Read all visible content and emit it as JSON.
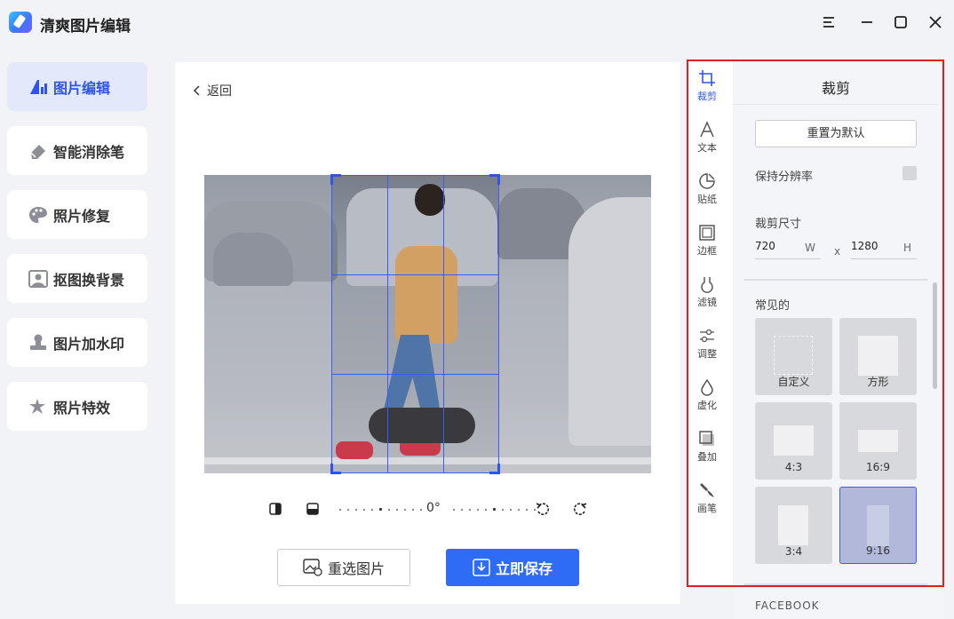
{
  "app": {
    "title": "清爽图片编辑",
    "window_controls": [
      "menu-icon",
      "minimize-icon",
      "maximize-icon",
      "close-icon"
    ]
  },
  "nav": {
    "items": [
      {
        "label": "图片编辑",
        "icon": "image-edit-icon",
        "active": true
      },
      {
        "label": "智能消除笔",
        "icon": "eraser-icon",
        "active": false
      },
      {
        "label": "照片修复",
        "icon": "palette-icon",
        "active": false
      },
      {
        "label": "抠图换背景",
        "icon": "portrait-icon",
        "active": false
      },
      {
        "label": "图片加水印",
        "icon": "stamp-icon",
        "active": false
      },
      {
        "label": "照片特效",
        "icon": "sparkle-icon",
        "active": false
      }
    ]
  },
  "editor": {
    "back_label": "返回",
    "rotation_angle": "0°",
    "reselect_label": "重选图片",
    "save_label": "立即保存"
  },
  "tools": [
    {
      "label": "裁剪",
      "icon": "crop-icon",
      "active": true
    },
    {
      "label": "文本",
      "icon": "text-icon",
      "active": false
    },
    {
      "label": "贴纸",
      "icon": "sticker-icon",
      "active": false
    },
    {
      "label": "边框",
      "icon": "frame-icon",
      "active": false
    },
    {
      "label": "滤镜",
      "icon": "filter-icon",
      "active": false
    },
    {
      "label": "调整",
      "icon": "adjust-icon",
      "active": false
    },
    {
      "label": "虚化",
      "icon": "blur-drop-icon",
      "active": false
    },
    {
      "label": "叠加",
      "icon": "overlay-icon",
      "active": false
    },
    {
      "label": "画笔",
      "icon": "brush-icon",
      "active": false
    }
  ],
  "crop_panel": {
    "title": "裁剪",
    "reset_label": "重置为默认",
    "keep_resolution_label": "保持分辨率",
    "size_label": "裁剪尺寸",
    "width_value": "720",
    "width_unit": "W",
    "separator": "x",
    "height_value": "1280",
    "height_unit": "H",
    "common_label": "常见的",
    "presets": [
      {
        "label": "自定义",
        "selected": false
      },
      {
        "label": "方形",
        "selected": false
      },
      {
        "label": "4:3",
        "selected": false
      },
      {
        "label": "16:9",
        "selected": false
      },
      {
        "label": "3:4",
        "selected": false
      },
      {
        "label": "9:16",
        "selected": true
      }
    ],
    "next_section_label": "FACEBOOK"
  },
  "colors": {
    "accent": "#2f54eb",
    "save_button": "#2f6cf6",
    "highlight_border": "#e0201e"
  }
}
